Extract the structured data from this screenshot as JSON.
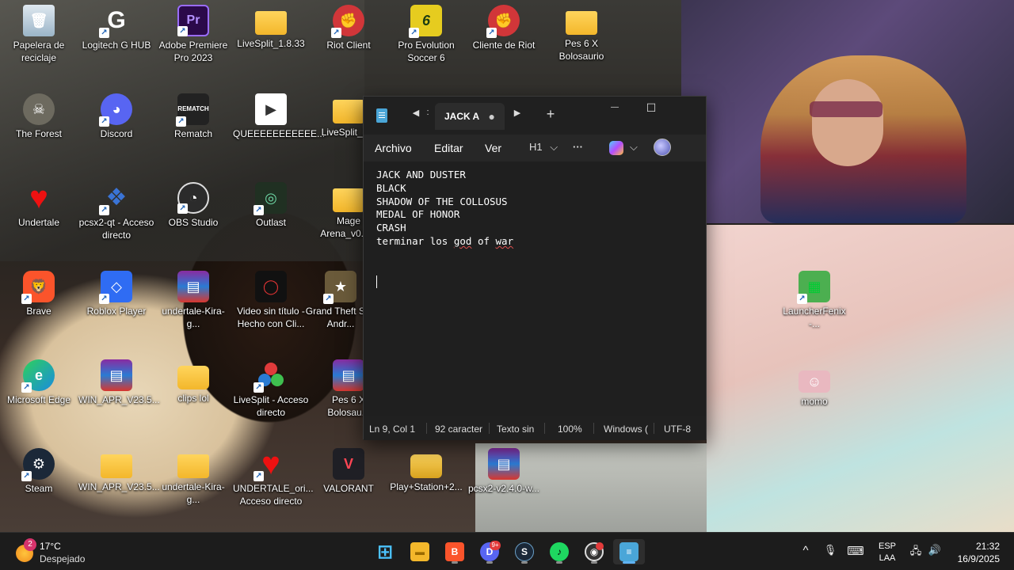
{
  "desktop": {
    "icons": [
      {
        "label": "Papelera de reciclaje",
        "icon": "recycle-bin-icon"
      },
      {
        "label": "Logitech G HUB",
        "icon": "logitech-icon"
      },
      {
        "label": "Adobe Premiere Pro 2023",
        "icon": "premiere-icon",
        "glyph": "Pr"
      },
      {
        "label": "LiveSplit_1.8.33",
        "icon": "folder-icon"
      },
      {
        "label": "Riot Client",
        "icon": "riot-icon"
      },
      {
        "label": "Pro Evolution Soccer 6",
        "icon": "pes-icon",
        "glyph": "6"
      },
      {
        "label": "Cliente de Riot",
        "icon": "riot-icon"
      },
      {
        "label": "Pes 6 X Bolosaurio",
        "icon": "folder-icon"
      },
      {
        "label": "The Forest",
        "icon": "forest-icon"
      },
      {
        "label": "Discord",
        "icon": "discord-icon"
      },
      {
        "label": "Rematch",
        "icon": "rematch-icon",
        "glyph": "REMATCH"
      },
      {
        "label": "QUEEEEEEEEEEE...",
        "icon": "media-file-icon"
      },
      {
        "label": "LiveSplit_1...",
        "icon": "folder-icon"
      },
      {
        "label": "Undertale",
        "icon": "heart-icon"
      },
      {
        "label": "pcsx2-qt - Acceso directo",
        "icon": "pcsx2-icon"
      },
      {
        "label": "OBS Studio",
        "icon": "obs-icon"
      },
      {
        "label": "Outlast",
        "icon": "outlast-icon"
      },
      {
        "label": "Mage Arena_v0.6.2",
        "icon": "folder-icon"
      },
      {
        "label": "Brave",
        "icon": "brave-icon"
      },
      {
        "label": "Roblox Player",
        "icon": "roblox-icon"
      },
      {
        "label": "undertale-Kira-g...",
        "icon": "winrar-icon"
      },
      {
        "label": "Video sin título - Hecho con Cli...",
        "icon": "video-icon"
      },
      {
        "label": "Grand Theft San Andr...",
        "icon": "gta-icon"
      },
      {
        "label": "Microsoft Edge",
        "icon": "edge-icon"
      },
      {
        "label": "WIN_APR_V23.5...",
        "icon": "winrar-icon"
      },
      {
        "label": "clips lol",
        "icon": "folder-icon"
      },
      {
        "label": "LiveSplit - Acceso directo",
        "icon": "livesplit-icon"
      },
      {
        "label": "Pes 6 X Bolosau...",
        "icon": "winrar-icon"
      },
      {
        "label": "Steam",
        "icon": "steam-icon"
      },
      {
        "label": "WIN_APR_V23.5...",
        "icon": "folder-icon"
      },
      {
        "label": "undertale-Kira-g...",
        "icon": "folder-icon"
      },
      {
        "label": "UNDERTALE_ori... Acceso directo",
        "icon": "heart-icon"
      },
      {
        "label": "VALORANT",
        "icon": "valorant-icon"
      },
      {
        "label": "Play+Station+2...",
        "icon": "folder-icon"
      },
      {
        "label": "pcsx2-v2.4.0-w...",
        "icon": "winrar-icon"
      },
      {
        "label": "LauncherFenix -...",
        "icon": "creeper-icon"
      },
      {
        "label": "momo",
        "icon": "image-icon"
      }
    ]
  },
  "notepad": {
    "tab_title": "JACK A",
    "unsaved_dot": "●",
    "nav_back": "◀",
    "nav_forward": "▶",
    "nav_sep": ":",
    "new_tab": "+",
    "minimize": "—",
    "maximize": "☐",
    "menu": {
      "file": "Archivo",
      "edit": "Editar",
      "view": "Ver"
    },
    "heading_label": "H1",
    "dropdown_glyph": "⌵",
    "more_glyph": "···",
    "lines": [
      "JACK AND DUSTER",
      "BLACK",
      "SHADOW OF THE COLLOSUS",
      "MEDAL OF HONOR",
      "CRASH",
      "terminar los god of war",
      "",
      ""
    ],
    "line6_prefix": "terminar los ",
    "line6_misspelled_1": "god",
    "line6_mid": " of ",
    "line6_misspelled_2": "war",
    "status": {
      "position": "Ln 9, Col 1",
      "chars": "92 caracter",
      "format": "Texto sin",
      "zoom": "100%",
      "eol": "Windows (",
      "encoding": "UTF-8"
    }
  },
  "taskbar": {
    "weather_badge": "2",
    "temperature": "17°C",
    "condition": "Despejado",
    "apps": [
      {
        "name": "start-button",
        "label": "⊞",
        "color": "#4cc2ff"
      },
      {
        "name": "file-explorer-icon",
        "label": "▬",
        "color": "#f3b72b"
      },
      {
        "name": "brave-icon",
        "label": "B",
        "color": "#fb542b"
      },
      {
        "name": "discord-icon",
        "label": "D",
        "color": "#5865f2",
        "badge": "9+"
      },
      {
        "name": "steam-icon",
        "label": "S",
        "color": "#1b2838"
      },
      {
        "name": "spotify-icon",
        "label": "♪",
        "color": "#1ed760"
      },
      {
        "name": "obs-icon",
        "label": "◉",
        "color": "#333333"
      },
      {
        "name": "notepad-icon",
        "label": "≡",
        "color": "#4aa6d8"
      }
    ],
    "tray_chevron": "^",
    "tray_mic": "🎙",
    "tray_keyboard": "⌨",
    "lang_line1": "ESP",
    "lang_line2": "LAA",
    "tray_network": "🖧",
    "tray_volume": "🔊",
    "time": "21:32",
    "date": "16/9/2025"
  }
}
